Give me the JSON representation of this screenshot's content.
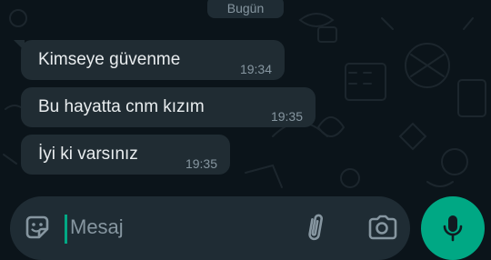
{
  "date_separator": "Bugün",
  "messages": [
    {
      "text": "Kimseye güvenme",
      "time": "19:34"
    },
    {
      "text": "Bu hayatta cnm kızım",
      "time": "19:35"
    },
    {
      "text": "İyi ki varsınız",
      "time": "19:35"
    }
  ],
  "composer": {
    "placeholder": "Mesaj",
    "value": "",
    "icons": {
      "emoji": "sticker-smile-icon",
      "attach": "paperclip-icon",
      "camera": "camera-icon",
      "send": "microphone-icon"
    }
  },
  "colors": {
    "background": "#0b141a",
    "incoming_bubble": "#202c33",
    "accent": "#00a884",
    "text_primary": "#e9edef",
    "text_secondary": "#8696a0"
  }
}
